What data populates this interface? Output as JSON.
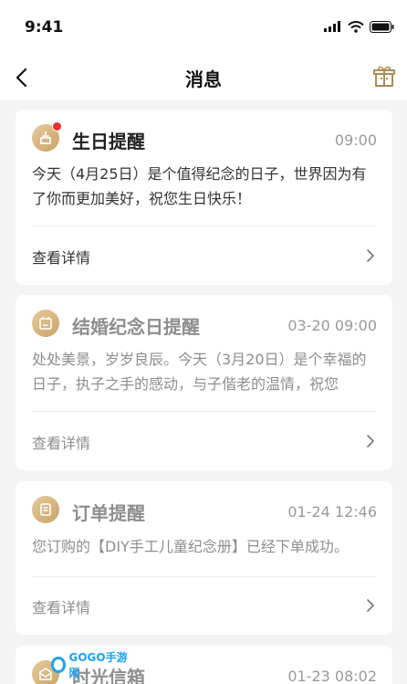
{
  "status_bar": {
    "time": "9:41"
  },
  "nav": {
    "title": "消息"
  },
  "messages": [
    {
      "title": "生日提醒",
      "time": "09:00",
      "body": "今天（4月25日）是个值得纪念的日子，世界因为有了你而更加美好，祝您生日快乐！",
      "link": "查看详情",
      "unread": true,
      "icon": "birthday-cake-icon"
    },
    {
      "title": "结婚纪念日提醒",
      "time": "03-20 09:00",
      "body": "处处美景，岁岁良辰。今天（3月20日）是个幸福的日子，执子之手的感动，与子偕老的温情，祝您",
      "link": "查看详情",
      "unread": false,
      "icon": "calendar-icon"
    },
    {
      "title": "订单提醒",
      "time": "01-24 12:46",
      "body": "您订购的【DIY手工儿童纪念册】已经下单成功。",
      "link": "查看详情",
      "unread": false,
      "icon": "order-list-icon"
    },
    {
      "title": "时光信箱",
      "time": "01-23 08:02",
      "unread": false,
      "icon": "mailbox-icon"
    }
  ],
  "watermark": {
    "text": "GOGO手游网"
  },
  "colors": {
    "accent": "#c9a46a",
    "unread_dot": "#e8302d",
    "muted": "#8e8e8e"
  }
}
